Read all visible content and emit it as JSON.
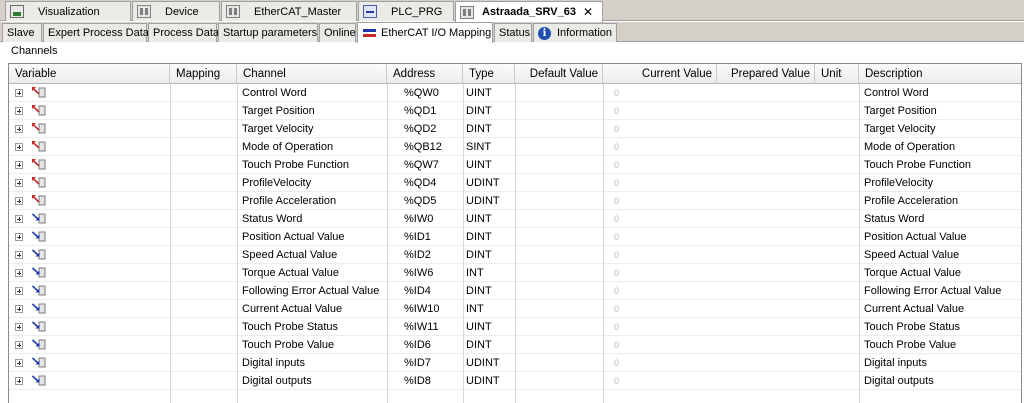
{
  "editor_tabs": [
    {
      "label": "Visualization",
      "icon": "visualization-icon"
    },
    {
      "label": "Device",
      "icon": "device-icon"
    },
    {
      "label": "EtherCAT_Master",
      "icon": "device-icon"
    },
    {
      "label": "PLC_PRG",
      "icon": "program-icon"
    },
    {
      "label": "Astraada_SRV_63",
      "icon": "device-icon",
      "close": "✕"
    }
  ],
  "sub_tabs": [
    {
      "label": "Slave"
    },
    {
      "label": "Expert Process Data"
    },
    {
      "label": "Process Data"
    },
    {
      "label": "Startup parameters"
    },
    {
      "label": "Online"
    },
    {
      "label": "EtherCAT I/O Mapping"
    },
    {
      "label": "Status"
    },
    {
      "label": "Information"
    }
  ],
  "channels": {
    "group_label": "Channels",
    "columns": [
      "Variable",
      "Mapping",
      "Channel",
      "Address",
      "Type",
      "Default Value",
      "Current Value",
      "Prepared Value",
      "Unit",
      "Description"
    ],
    "rows": [
      {
        "channel": "Control Word",
        "address": "%QW0",
        "type": "UINT",
        "current": "0",
        "description": "Control Word",
        "dir": "output"
      },
      {
        "channel": "Target Position",
        "address": "%QD1",
        "type": "DINT",
        "current": "0",
        "description": "Target Position",
        "dir": "output"
      },
      {
        "channel": "Target Velocity",
        "address": "%QD2",
        "type": "DINT",
        "current": "0",
        "description": "Target Velocity",
        "dir": "output"
      },
      {
        "channel": "Mode of Operation",
        "address": "%QB12",
        "type": "SINT",
        "current": "0",
        "description": "Mode of Operation",
        "dir": "output"
      },
      {
        "channel": "Touch Probe Function",
        "address": "%QW7",
        "type": "UINT",
        "current": "0",
        "description": "Touch Probe Function",
        "dir": "output"
      },
      {
        "channel": "ProfileVelocity",
        "address": "%QD4",
        "type": "UDINT",
        "current": "0",
        "description": "ProfileVelocity",
        "dir": "output"
      },
      {
        "channel": "Profile Acceleration",
        "address": "%QD5",
        "type": "UDINT",
        "current": "0",
        "description": "Profile Acceleration",
        "dir": "output"
      },
      {
        "channel": "Status Word",
        "address": "%IW0",
        "type": "UINT",
        "current": "0",
        "description": "Status Word",
        "dir": "input"
      },
      {
        "channel": "Position Actual Value",
        "address": "%ID1",
        "type": "DINT",
        "current": "0",
        "description": "Position Actual Value",
        "dir": "input"
      },
      {
        "channel": "Speed Actual Value",
        "address": "%ID2",
        "type": "DINT",
        "current": "0",
        "description": "Speed Actual Value",
        "dir": "input"
      },
      {
        "channel": "Torque Actual Value",
        "address": "%IW6",
        "type": "INT",
        "current": "0",
        "description": "Torque Actual Value",
        "dir": "input"
      },
      {
        "channel": "Following Error Actual Value",
        "address": "%ID4",
        "type": "DINT",
        "current": "0",
        "description": "Following Error Actual Value",
        "dir": "input"
      },
      {
        "channel": "Current Actual Value",
        "address": "%IW10",
        "type": "INT",
        "current": "0",
        "description": "Current Actual Value",
        "dir": "input"
      },
      {
        "channel": "Touch Probe Status",
        "address": "%IW11",
        "type": "UINT",
        "current": "0",
        "description": "Touch Probe Status",
        "dir": "input"
      },
      {
        "channel": "Touch Probe Value",
        "address": "%ID6",
        "type": "DINT",
        "current": "0",
        "description": "Touch Probe Value",
        "dir": "input"
      },
      {
        "channel": "Digital inputs",
        "address": "%ID7",
        "type": "UDINT",
        "current": "0",
        "description": "Digital inputs",
        "dir": "input"
      },
      {
        "channel": "Digital outputs",
        "address": "%ID8",
        "type": "UDINT",
        "current": "0",
        "description": "Digital outputs",
        "dir": "input"
      }
    ]
  },
  "colors": {
    "output_arrow": "#c62828",
    "input_arrow": "#1f3aa8",
    "io_map_red": "#c62828",
    "io_map_blue": "#1f3aa8"
  }
}
